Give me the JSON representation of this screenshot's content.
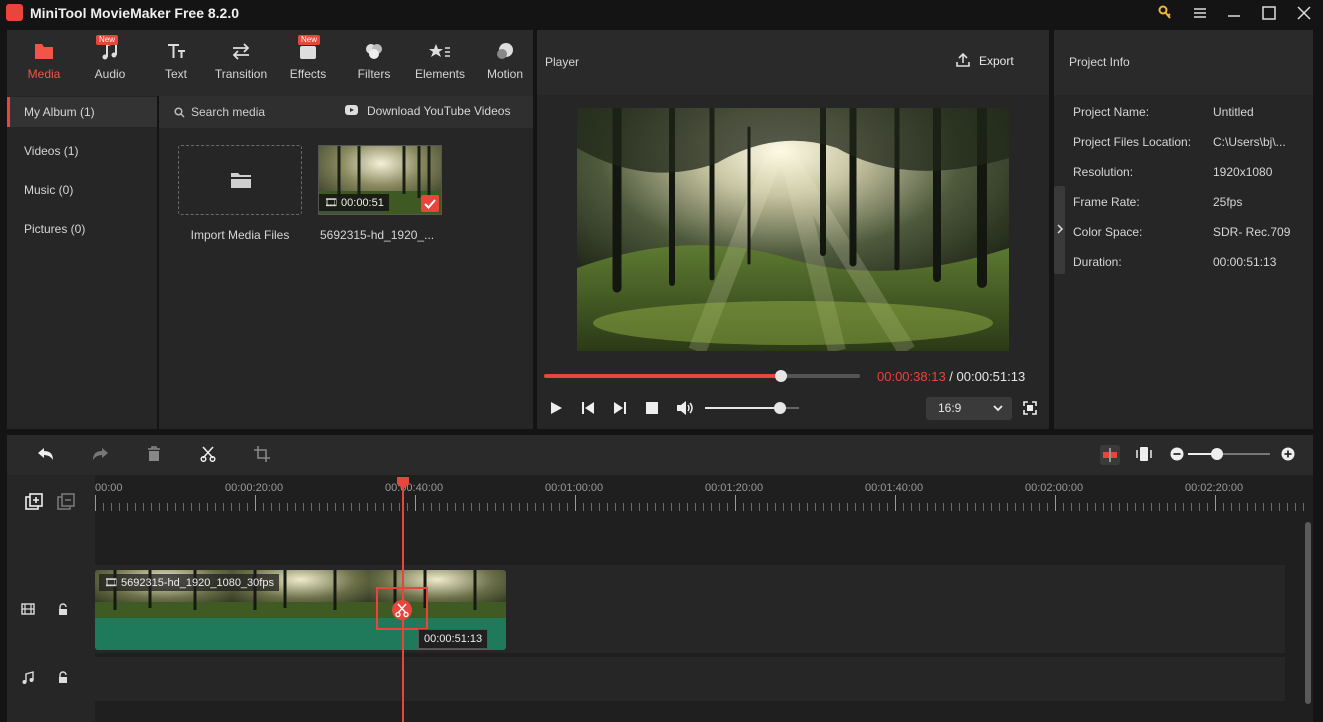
{
  "app": {
    "title": "MiniTool MovieMaker Free 8.2.0",
    "colors": {
      "accent": "#e8453c",
      "panel": "#262626",
      "clip": "#1e7a5a"
    }
  },
  "toolbar": {
    "tabs": [
      {
        "label": "Media",
        "icon": "folder-icon",
        "active": true
      },
      {
        "label": "Audio",
        "icon": "music-note-icon",
        "badge": "New"
      },
      {
        "label": "Text",
        "icon": "text-icon"
      },
      {
        "label": "Transition",
        "icon": "transition-arrows-icon"
      },
      {
        "label": "Effects",
        "icon": "effects-icon",
        "badge": "New"
      },
      {
        "label": "Filters",
        "icon": "filters-icon"
      },
      {
        "label": "Elements",
        "icon": "elements-icon"
      },
      {
        "label": "Motion",
        "icon": "motion-icon"
      }
    ]
  },
  "sidebar": {
    "items": [
      {
        "label": "My Album (1)",
        "active": true
      },
      {
        "label": "Videos (1)"
      },
      {
        "label": "Music (0)"
      },
      {
        "label": "Pictures (0)"
      }
    ]
  },
  "media": {
    "search_placeholder": "Search media",
    "download_label": "Download YouTube Videos",
    "import_label": "Import Media Files",
    "items": [
      {
        "name": "5692315-hd_1920_...",
        "duration": "00:00:51"
      }
    ]
  },
  "player": {
    "title": "Player",
    "export_label": "Export",
    "current_time": "00:00:38:13",
    "separator": " / ",
    "total_time": "00:00:51:13",
    "progress": 0.75,
    "volume": 0.8,
    "aspect_ratio": "16:9"
  },
  "project_info": {
    "title": "Project Info",
    "rows": [
      {
        "key": "Project Name:",
        "value": "Untitled"
      },
      {
        "key": "Project Files Location:",
        "value": "C:\\Users\\bj\\..."
      },
      {
        "key": "Resolution:",
        "value": "1920x1080"
      },
      {
        "key": "Frame Rate:",
        "value": "25fps"
      },
      {
        "key": "Color Space:",
        "value": "SDR- Rec.709"
      },
      {
        "key": "Duration:",
        "value": "00:00:51:13"
      }
    ]
  },
  "timeline": {
    "ruler_labels": [
      "00:00",
      "00:00:20:00",
      "00:00:40:00",
      "00:01:00:00",
      "00:01:20:00",
      "00:01:40:00",
      "00:02:00:00",
      "00:02:20:00"
    ],
    "clip_name": "5692315-hd_1920_1080_30fps",
    "split_time": "00:00:51:13",
    "zoom": 0.35
  }
}
